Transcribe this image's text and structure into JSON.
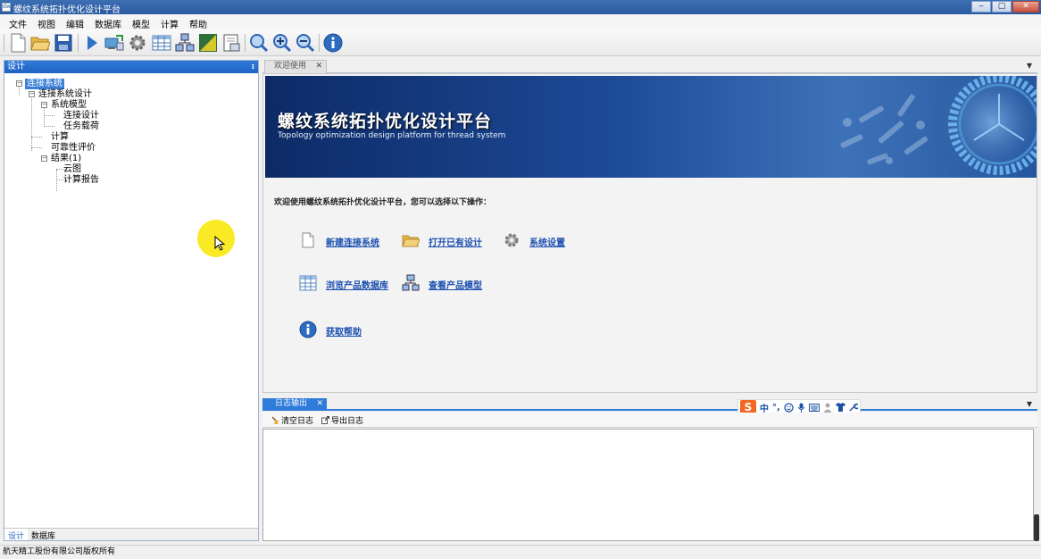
{
  "window": {
    "title": "螺纹系统拓扑优化设计平台",
    "icon_label": "dw"
  },
  "window_controls": {
    "minimize": "‒",
    "restore": "▢",
    "close": "✕"
  },
  "menubar": [
    "文件",
    "视图",
    "编辑",
    "数据库",
    "模型",
    "计算",
    "帮助"
  ],
  "toolbar": {
    "buttons": [
      "new-file-icon",
      "open-folder-icon",
      "save-icon",
      "run-icon",
      "monitor-icon",
      "gear-icon",
      "table-icon",
      "network-icon",
      "chart-icon",
      "report-icon",
      "zoom-icon",
      "zoom-in-icon",
      "zoom-out-icon",
      "info-icon"
    ]
  },
  "left_panel": {
    "title": "设计",
    "pin": "ᵻ",
    "tree": {
      "root": "连接系统",
      "design": "连接系统设计",
      "model": "系统模型",
      "conn_design": "连接设计",
      "task_load": "任务载荷",
      "calc": "计算",
      "reliability": "可靠性评价",
      "result": "结果(1)",
      "cloud": "云图",
      "report": "计算报告"
    },
    "tabs": [
      "设计",
      "数据库"
    ]
  },
  "welcome": {
    "tab_label": "欢迎使用",
    "tab_close": "✕",
    "dropdown": "▼",
    "banner_title": "螺纹系统拓扑优化设计平台",
    "banner_subtitle": "Topology optimization design platform for thread system",
    "intro": "欢迎使用螺纹系统拓扑优化设计平台，您可以选择以下操作：",
    "actions": {
      "new": "新建连接系统",
      "open": "打开已有设计",
      "settings": "系统设置",
      "browse": "浏览产品数据库",
      "view_model": "查看产品模型",
      "help": "获取帮助"
    }
  },
  "log": {
    "tab_label": "日志输出",
    "tab_close": "✕",
    "dropdown": "▼",
    "clear": "清空日志",
    "export": "导出日志"
  },
  "ime": {
    "logo": "S",
    "mode": "中",
    "punct": "°,"
  },
  "statusbar": {
    "text": "航天精工股份有限公司版权所有"
  },
  "colors": {
    "accent": "#2e7bd9",
    "link": "#1b4fb0",
    "banner": "#1d4a97",
    "highlight": "#fae814"
  }
}
